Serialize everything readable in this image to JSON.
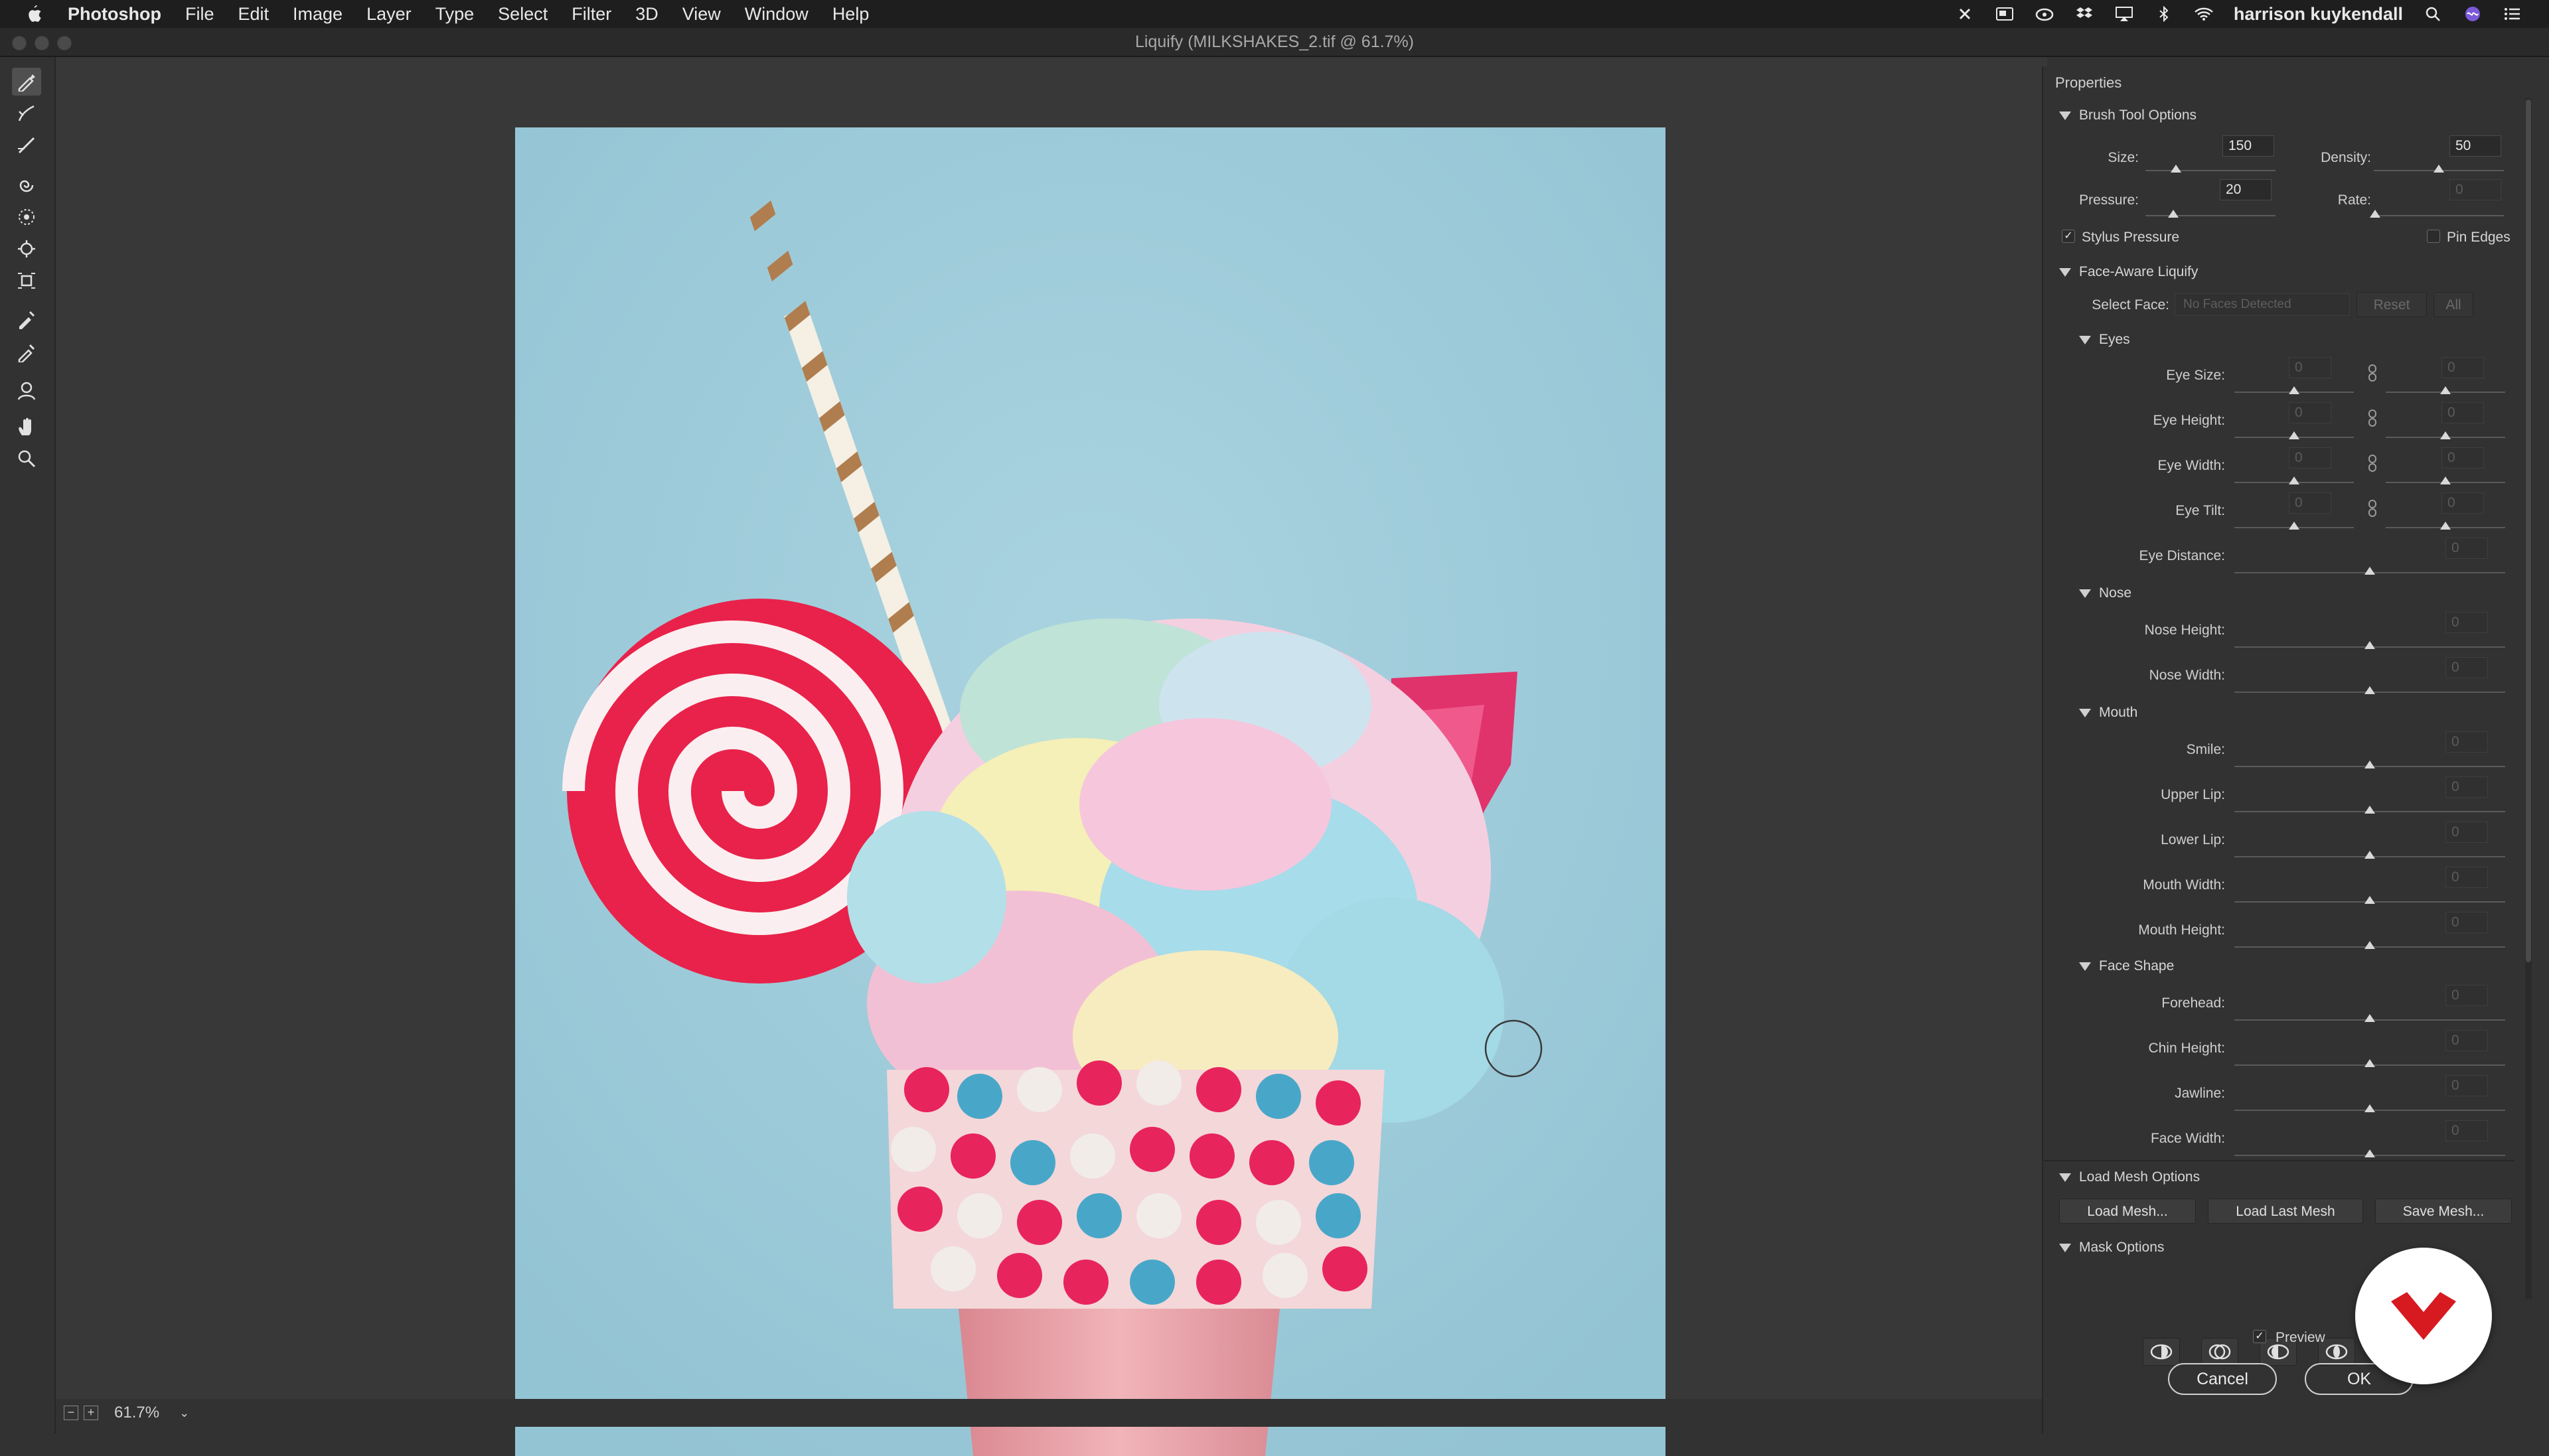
{
  "menubar": {
    "app_name": "Photoshop",
    "items": [
      "File",
      "Edit",
      "Image",
      "Layer",
      "Type",
      "Select",
      "Filter",
      "3D",
      "View",
      "Window",
      "Help"
    ],
    "user": "harrison kuykendall"
  },
  "window": {
    "title": "Liquify (MILKSHAKES_2.tif @ 61.7%)"
  },
  "status": {
    "zoom": "61.7%"
  },
  "panel": {
    "title": "Properties",
    "brush": {
      "header": "Brush Tool Options",
      "size_label": "Size:",
      "size_value": "150",
      "density_label": "Density:",
      "density_value": "50",
      "pressure_label": "Pressure:",
      "pressure_value": "20",
      "rate_label": "Rate:",
      "rate_value": "0",
      "stylus_label": "Stylus Pressure",
      "pin_edges_label": "Pin Edges"
    },
    "face": {
      "header": "Face-Aware Liquify",
      "select_face_label": "Select Face:",
      "select_face_value": "No Faces Detected",
      "reset_label": "Reset",
      "all_label": "All",
      "eyes_header": "Eyes",
      "eye_size": "Eye Size:",
      "eye_height": "Eye Height:",
      "eye_width": "Eye Width:",
      "eye_tilt": "Eye Tilt:",
      "eye_distance": "Eye Distance:",
      "nose_header": "Nose",
      "nose_height": "Nose Height:",
      "nose_width": "Nose Width:",
      "mouth_header": "Mouth",
      "smile": "Smile:",
      "upper_lip": "Upper Lip:",
      "lower_lip": "Lower Lip:",
      "mouth_width": "Mouth Width:",
      "mouth_height": "Mouth Height:",
      "face_shape_header": "Face Shape",
      "forehead": "Forehead:",
      "chin_height": "Chin Height:",
      "jawline": "Jawline:",
      "face_width": "Face Width:",
      "zero": "0"
    },
    "mesh": {
      "header": "Load Mesh Options",
      "load_mesh": "Load Mesh...",
      "load_last": "Load Last Mesh",
      "save_mesh": "Save Mesh..."
    },
    "mask": {
      "header": "Mask Options"
    },
    "preview_label": "Preview",
    "cancel_label": "Cancel",
    "ok_label": "OK"
  }
}
